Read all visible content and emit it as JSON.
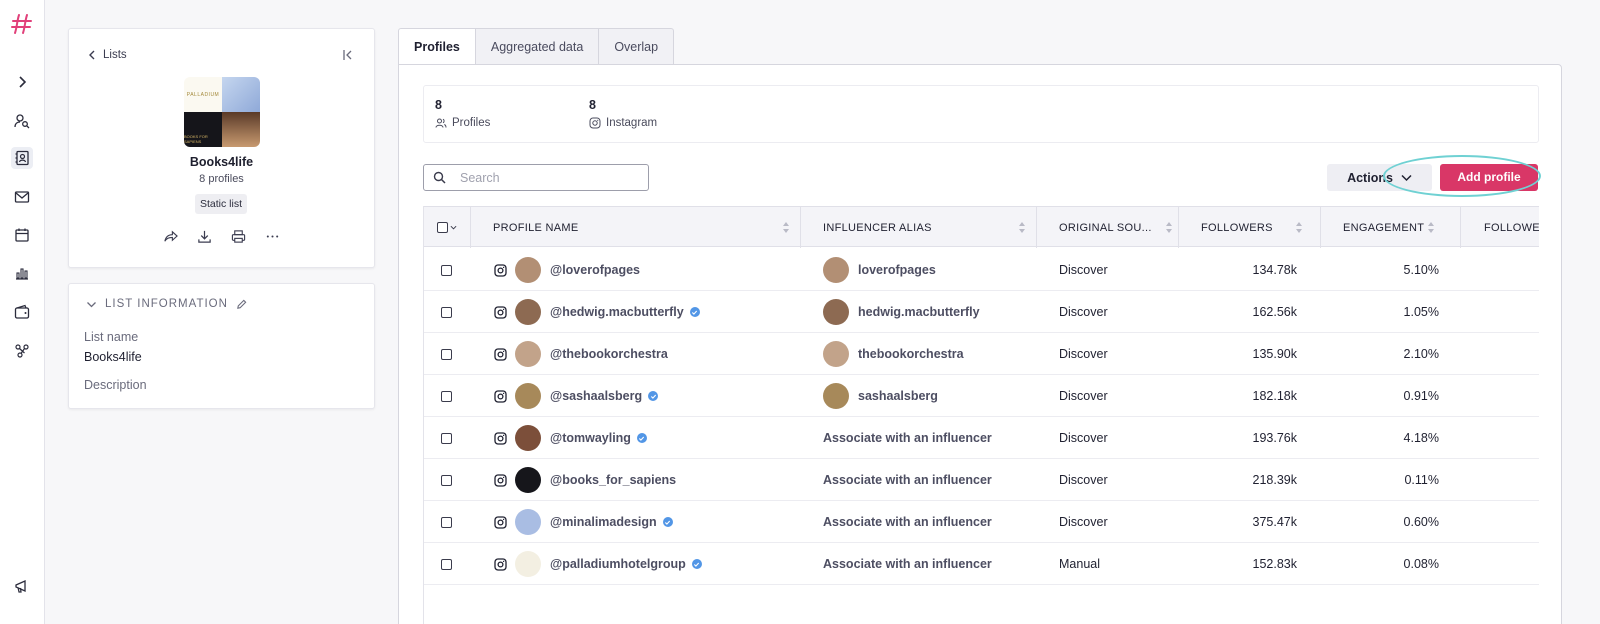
{
  "colors": {
    "accent": "#d93767",
    "highlight": "#6fd1d3",
    "verified": "#5296e6"
  },
  "nav": {
    "items": [
      {
        "name": "expand-icon"
      },
      {
        "name": "user-search-icon"
      },
      {
        "name": "contact-lists-icon"
      },
      {
        "name": "mail-icon"
      },
      {
        "name": "calendar-icon"
      },
      {
        "name": "bar-chart-icon"
      },
      {
        "name": "wallet-icon"
      },
      {
        "name": "network-icon"
      }
    ],
    "bottom": {
      "name": "megaphone-icon"
    }
  },
  "list_card": {
    "back_label": "Lists",
    "mosaic_label_1": "PALLADIUM",
    "mosaic_label_3": "BOOKS FOR SAPIENS",
    "title": "Books4life",
    "count": "8 profiles",
    "badge": "Static list"
  },
  "info_card": {
    "heading": "LIST INFORMATION",
    "name_label": "List name",
    "name_value": "Books4life",
    "description_label": "Description"
  },
  "tabs": [
    {
      "label": "Profiles",
      "active": true
    },
    {
      "label": "Aggregated data",
      "active": false
    },
    {
      "label": "Overlap",
      "active": false
    }
  ],
  "stats": {
    "profiles": {
      "value": "8",
      "label": "Profiles"
    },
    "instagram": {
      "value": "8",
      "label": "Instagram"
    }
  },
  "search": {
    "placeholder": "Search",
    "value": ""
  },
  "toolbar": {
    "actions_label": "Actions",
    "add_profile_label": "Add profile"
  },
  "table": {
    "columns": [
      "PROFILE NAME",
      "INFLUENCER ALIAS",
      "ORIGINAL SOU...",
      "FOLLOWERS",
      "ENGAGEMENT",
      "FOLLOWE"
    ],
    "rows": [
      {
        "handle": "@loverofpages",
        "verified": false,
        "alias": "loverofpages",
        "has_alias": true,
        "source": "Discover",
        "followers": "134.78k",
        "engagement": "5.10%",
        "avatar": "#b28f74"
      },
      {
        "handle": "@hedwig.macbutterfly",
        "verified": true,
        "alias": "hedwig.macbutterfly",
        "has_alias": true,
        "source": "Discover",
        "followers": "162.56k",
        "engagement": "1.05%",
        "avatar": "#8d6a52"
      },
      {
        "handle": "@thebookorchestra",
        "verified": false,
        "alias": "thebookorchestra",
        "has_alias": true,
        "source": "Discover",
        "followers": "135.90k",
        "engagement": "2.10%",
        "avatar": "#c2a38a"
      },
      {
        "handle": "@sashaalsberg",
        "verified": true,
        "alias": "sashaalsberg",
        "has_alias": true,
        "source": "Discover",
        "followers": "182.18k",
        "engagement": "0.91%",
        "avatar": "#a7895a"
      },
      {
        "handle": "@tomwayling",
        "verified": true,
        "alias": "Associate with an influencer",
        "has_alias": false,
        "source": "Discover",
        "followers": "193.76k",
        "engagement": "4.18%",
        "avatar": "#7c4f3a"
      },
      {
        "handle": "@books_for_sapiens",
        "verified": false,
        "alias": "Associate with an influencer",
        "has_alias": false,
        "source": "Discover",
        "followers": "218.39k",
        "engagement": "0.11%",
        "avatar": "#16161b"
      },
      {
        "handle": "@minalimadesign",
        "verified": true,
        "alias": "Associate with an influencer",
        "has_alias": false,
        "source": "Discover",
        "followers": "375.47k",
        "engagement": "0.60%",
        "avatar": "#a9bde3"
      },
      {
        "handle": "@palladiumhotelgroup",
        "verified": true,
        "alias": "Associate with an influencer",
        "has_alias": false,
        "source": "Manual",
        "followers": "152.83k",
        "engagement": "0.08%",
        "avatar": "#f3efe2"
      }
    ]
  }
}
